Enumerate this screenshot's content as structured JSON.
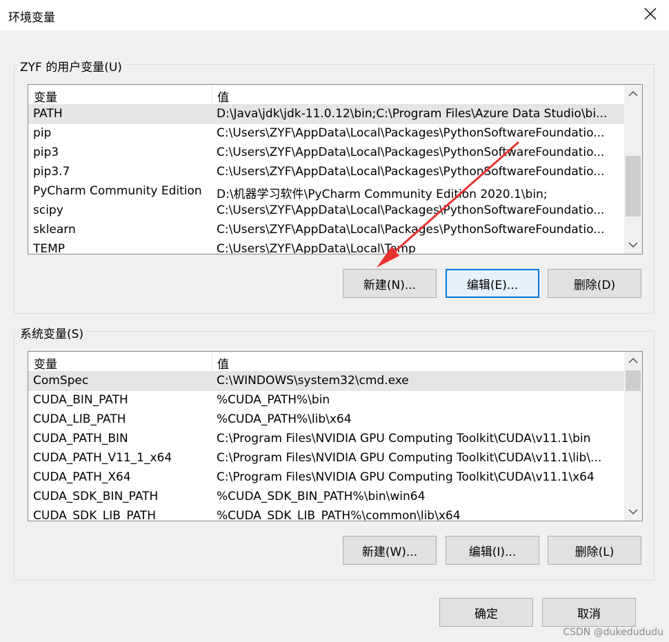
{
  "window": {
    "title": "环境变量",
    "close_icon": "close-icon"
  },
  "user_vars": {
    "group_label": "ZYF 的用户变量(U)",
    "col_variable": "变量",
    "col_value": "值",
    "rows": [
      {
        "name": "PATH",
        "value": "D:\\Java\\jdk\\jdk-11.0.12\\bin;C:\\Program Files\\Azure Data Studio\\bi..."
      },
      {
        "name": "pip",
        "value": "C:\\Users\\ZYF\\AppData\\Local\\Packages\\PythonSoftwareFoundatio..."
      },
      {
        "name": "pip3",
        "value": "C:\\Users\\ZYF\\AppData\\Local\\Packages\\PythonSoftwareFoundatio..."
      },
      {
        "name": "pip3.7",
        "value": "C:\\Users\\ZYF\\AppData\\Local\\Packages\\PythonSoftwareFoundatio..."
      },
      {
        "name": "PyCharm Community Edition",
        "value": "D:\\机器学习软件\\PyCharm Community Edition 2020.1\\bin;"
      },
      {
        "name": "scipy",
        "value": "C:\\Users\\ZYF\\AppData\\Local\\Packages\\PythonSoftwareFoundatio..."
      },
      {
        "name": "sklearn",
        "value": "C:\\Users\\ZYF\\AppData\\Local\\Packages\\PythonSoftwareFoundatio..."
      },
      {
        "name": "TEMP",
        "value": "C:\\Users\\ZYF\\AppData\\Local\\Temp"
      }
    ],
    "new_button": "新建(N)...",
    "edit_button": "编辑(E)...",
    "delete_button": "删除(D)"
  },
  "system_vars": {
    "group_label": "系统变量(S)",
    "col_variable": "变量",
    "col_value": "值",
    "rows": [
      {
        "name": "ComSpec",
        "value": "C:\\WINDOWS\\system32\\cmd.exe"
      },
      {
        "name": "CUDA_BIN_PATH",
        "value": "%CUDA_PATH%\\bin"
      },
      {
        "name": "CUDA_LIB_PATH",
        "value": "%CUDA_PATH%\\lib\\x64"
      },
      {
        "name": "CUDA_PATH_BIN",
        "value": "C:\\Program Files\\NVIDIA GPU Computing Toolkit\\CUDA\\v11.1\\bin"
      },
      {
        "name": "CUDA_PATH_V11_1_x64",
        "value": "C:\\Program Files\\NVIDIA GPU Computing Toolkit\\CUDA\\v11.1\\lib\\..."
      },
      {
        "name": "CUDA_PATH_X64",
        "value": "C:\\Program Files\\NVIDIA GPU Computing Toolkit\\CUDA\\v11.1\\x64"
      },
      {
        "name": "CUDA_SDK_BIN_PATH",
        "value": "%CUDA_SDK_BIN_PATH%\\bin\\win64"
      },
      {
        "name": "CUDA_SDK_LIB_PATH",
        "value": "%CUDA_SDK_LIB_PATH%\\common\\lib\\x64"
      }
    ],
    "new_button": "新建(W)...",
    "edit_button": "编辑(I)...",
    "delete_button": "删除(L)"
  },
  "footer": {
    "ok_button": "确定",
    "cancel_button": "取消"
  },
  "watermark": "CSDN @dukedududu",
  "colors": {
    "annotation_arrow": "#e8322f",
    "focus_border": "#0078d7"
  }
}
